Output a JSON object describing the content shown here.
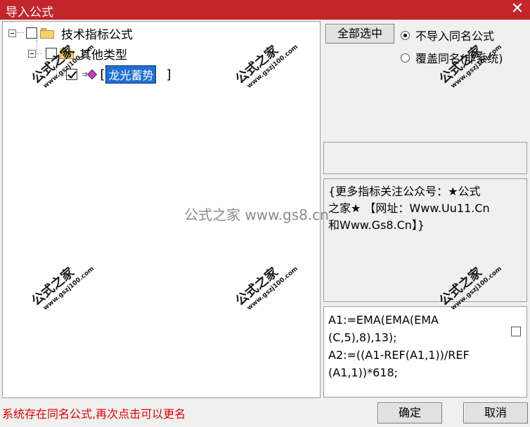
{
  "window": {
    "title": "导入公式",
    "close_glyph": "✕",
    "accent_color": "#c2262b"
  },
  "tree": {
    "root_label": "技术指标公式",
    "group_label": "其他类型",
    "item_label": "龙光蓄势",
    "item_checked": true
  },
  "actions": {
    "select_all": "全部选中",
    "radio_skip": "不导入同名公式",
    "radio_overwrite": "覆盖同名(非系统)",
    "radio_selected": "skip"
  },
  "info": {
    "text_line1": "{更多指标关注公众号：★公式",
    "text_line2": "之家★ 【网址：Www.Uu11.Cn",
    "text_line3": "和Www.Gs8.Cn】}"
  },
  "code": {
    "line1": "A1:=EMA(EMA(EMA",
    "line2": "(C,5),8),13);",
    "line3": "A2:=((A1-REF(A1,1))/REF",
    "line4": "(A1,1))*618;"
  },
  "status": {
    "message": "系统存在同名公式,再次点击可以更名"
  },
  "footer": {
    "ok_label": "确定",
    "cancel_label": "取消"
  },
  "watermark": {
    "center_text": "公式之家 www.gs8.cn",
    "stamp_text": "公式之家",
    "stamp_url": "www.gszj100.com"
  }
}
